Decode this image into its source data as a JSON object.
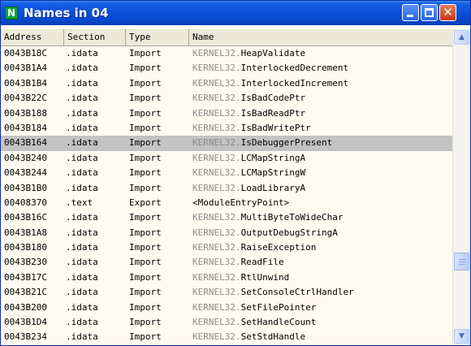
{
  "window": {
    "app_icon_letter": "N",
    "title": "Names in 04",
    "close_glyph": "✕"
  },
  "columns": {
    "address": "Address",
    "section": "Section",
    "type": "Type",
    "name": "Name"
  },
  "scrollbar": {
    "up_glyph": "▲",
    "down_glyph": "▼",
    "position_fraction": 0.78
  },
  "selected_row": 6,
  "rows": [
    {
      "address": "0043B18C",
      "section": ".idata",
      "type": "Import",
      "lib": "KERNEL32.",
      "name": "HeapValidate"
    },
    {
      "address": "0043B1A4",
      "section": ".idata",
      "type": "Import",
      "lib": "KERNEL32.",
      "name": "InterlockedDecrement"
    },
    {
      "address": "0043B1B4",
      "section": ".idata",
      "type": "Import",
      "lib": "KERNEL32.",
      "name": "InterlockedIncrement"
    },
    {
      "address": "0043B22C",
      "section": ".idata",
      "type": "Import",
      "lib": "KERNEL32.",
      "name": "IsBadCodePtr"
    },
    {
      "address": "0043B188",
      "section": ".idata",
      "type": "Import",
      "lib": "KERNEL32.",
      "name": "IsBadReadPtr"
    },
    {
      "address": "0043B184",
      "section": ".idata",
      "type": "Import",
      "lib": "KERNEL32.",
      "name": "IsBadWritePtr"
    },
    {
      "address": "0043B164",
      "section": ".idata",
      "type": "Import",
      "lib": "KERNEL32.",
      "name": "IsDebuggerPresent"
    },
    {
      "address": "0043B240",
      "section": ".idata",
      "type": "Import",
      "lib": "KERNEL32.",
      "name": "LCMapStringA"
    },
    {
      "address": "0043B244",
      "section": ".idata",
      "type": "Import",
      "lib": "KERNEL32.",
      "name": "LCMapStringW"
    },
    {
      "address": "0043B1B0",
      "section": ".idata",
      "type": "Import",
      "lib": "KERNEL32.",
      "name": "LoadLibraryA"
    },
    {
      "address": "00408370",
      "section": ".text",
      "type": "Export",
      "lib": "",
      "name": "<ModuleEntryPoint>"
    },
    {
      "address": "0043B16C",
      "section": ".idata",
      "type": "Import",
      "lib": "KERNEL32.",
      "name": "MultiByteToWideChar"
    },
    {
      "address": "0043B1A8",
      "section": ".idata",
      "type": "Import",
      "lib": "KERNEL32.",
      "name": "OutputDebugStringA"
    },
    {
      "address": "0043B180",
      "section": ".idata",
      "type": "Import",
      "lib": "KERNEL32.",
      "name": "RaiseException"
    },
    {
      "address": "0043B230",
      "section": ".idata",
      "type": "Import",
      "lib": "KERNEL32.",
      "name": "ReadFile"
    },
    {
      "address": "0043B17C",
      "section": ".idata",
      "type": "Import",
      "lib": "KERNEL32.",
      "name": "RtlUnwind"
    },
    {
      "address": "0043B21C",
      "section": ".idata",
      "type": "Import",
      "lib": "KERNEL32.",
      "name": "SetConsoleCtrlHandler"
    },
    {
      "address": "0043B200",
      "section": ".idata",
      "type": "Import",
      "lib": "KERNEL32.",
      "name": "SetFilePointer"
    },
    {
      "address": "0043B1D4",
      "section": ".idata",
      "type": "Import",
      "lib": "KERNEL32.",
      "name": "SetHandleCount"
    },
    {
      "address": "0043B234",
      "section": ".idata",
      "type": "Import",
      "lib": "KERNEL32.",
      "name": "SetStdHandle"
    }
  ]
}
